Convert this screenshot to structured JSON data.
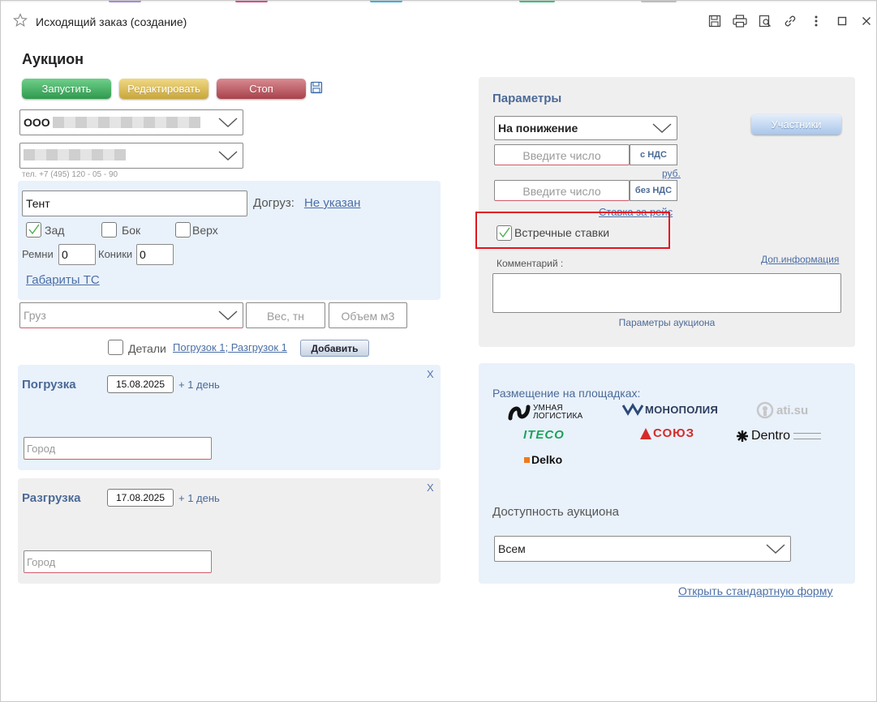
{
  "window": {
    "title": "Исходящий заказ (создание)"
  },
  "page": {
    "title": "Аукцион"
  },
  "actions": {
    "start": "Запустить",
    "edit": "Редактировать",
    "stop": "Стоп"
  },
  "company": {
    "org_prefix": "ООО",
    "phone": "тел. +7 (495) 120 - 05 - 90"
  },
  "vehicle": {
    "body_type": "Тент",
    "extra_load_label": "Догруз:",
    "extra_load_value": "Не указан",
    "loading": [
      {
        "label": "Зад",
        "checked": true
      },
      {
        "label": "Бок",
        "checked": false
      },
      {
        "label": "Верх",
        "checked": false
      }
    ],
    "straps_label": "Ремни",
    "straps_value": "0",
    "cones_label": "Коники",
    "cones_value": "0",
    "dimensions_link": "Габариты ТС"
  },
  "cargo": {
    "cargo_placeholder": "Груз",
    "weight_placeholder": "Вес, тн",
    "volume_placeholder": "Объем м3",
    "details_label": "Детали",
    "details_link": "Погрузок 1; Разгрузок 1",
    "add_button": "Добавить"
  },
  "loading_point": {
    "title": "Погрузка",
    "date": "15.08.2025",
    "offset": "+ 1 день",
    "city_placeholder": "Город",
    "close": "X"
  },
  "unloading_point": {
    "title": "Разгрузка",
    "date": "17.08.2025",
    "offset": "+ 1 день",
    "city_placeholder": "Город",
    "close": "X"
  },
  "params": {
    "title": "Параметры",
    "mode": "На понижение",
    "participants_button": "Участники",
    "price_with_vat_placeholder": "Введите число",
    "with_vat": "с НДС",
    "currency": "руб.",
    "price_without_vat_placeholder": "Введите число",
    "without_vat": "без НДС",
    "rate_per_trip": "Ставка за рейс",
    "counter_bids": "Встречные ставки",
    "counter_bids_checked": true,
    "comment_label": "Комментарий :",
    "extra_info": "Доп.информация",
    "auction_params": "Параметры аукциона"
  },
  "placement": {
    "title": "Размещение на площадках:",
    "platforms": [
      "УМНАЯ ЛОГИСТИКА",
      "МОНОПОЛИЯ",
      "ati.su",
      "ITECO",
      "СОЮЗ",
      "Dentro",
      "Delko"
    ],
    "availability_title": "Доступность аукциона",
    "availability_value": "Всем",
    "open_standard_form": "Открыть стандартную форму"
  },
  "colors": {
    "start": "#2e9a4e",
    "edit": "#c9a63a",
    "stop": "#a8424c",
    "accent": "#4b6a96",
    "highlight": "#e3141e"
  }
}
